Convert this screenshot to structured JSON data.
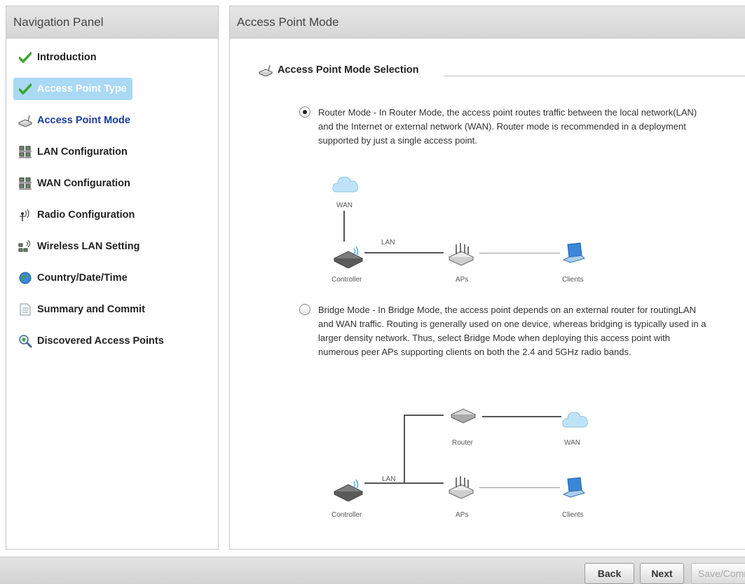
{
  "nav": {
    "title": "Navigation Panel",
    "items": [
      {
        "label": "Introduction",
        "icon": "check-icon"
      },
      {
        "label": "Access Point Type",
        "icon": "check-icon"
      },
      {
        "label": "Access Point Mode",
        "icon": "access-point-icon"
      },
      {
        "label": "LAN Configuration",
        "icon": "network-icon"
      },
      {
        "label": "WAN Configuration",
        "icon": "network-icon"
      },
      {
        "label": "Radio Configuration",
        "icon": "antenna-icon"
      },
      {
        "label": "Wireless LAN Setting",
        "icon": "wireless-network-icon"
      },
      {
        "label": "Country/Date/Time",
        "icon": "globe-icon"
      },
      {
        "label": "Summary and Commit",
        "icon": "document-icon"
      },
      {
        "label": "Discovered Access Points",
        "icon": "magnifier-icon"
      }
    ]
  },
  "main": {
    "title": "Access Point Mode",
    "section_label": "Access Point Mode Selection",
    "router": {
      "description": "Router Mode - In Router Mode, the access point routes traffic between the local network(LAN) and the Internet or external network (WAN). Router mode is recommended in a deployment supported by just a single access point.",
      "selected": true,
      "labels": {
        "wan": "WAN",
        "lan": "LAN",
        "controller": "Controller",
        "aps": "APs",
        "clients": "Clients"
      }
    },
    "bridge": {
      "description": "Bridge Mode - In Bridge Mode, the access point depends on an external router for routingLAN and WAN traffic. Routing is generally used on one device, whereas bridging is typically used in a larger density network. Thus, select Bridge Mode when deploying this access point with numerous peer APs supporting clients on both the 2.4 and 5GHz radio bands.",
      "selected": false,
      "labels": {
        "router": "Router",
        "wan": "WAN",
        "lan": "LAN",
        "controller": "Controller",
        "aps": "APs",
        "clients": "Clients"
      }
    }
  },
  "footer": {
    "back": "Back",
    "next": "Next",
    "save": "Save/Commit"
  },
  "colors": {
    "selected_bg": "#a9d9f5",
    "current_text": "#1a3c9e",
    "check_green": "#3aa62c"
  }
}
